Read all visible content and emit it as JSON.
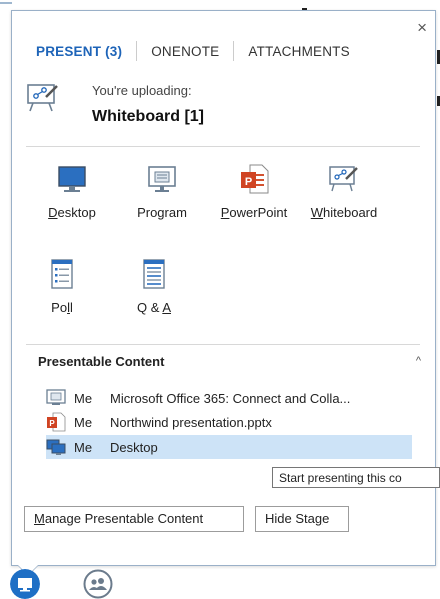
{
  "window": {
    "close_symbol": "×"
  },
  "tabs": [
    {
      "label": "PRESENT (3)",
      "active": true
    },
    {
      "label": "ONENOTE",
      "active": false
    },
    {
      "label": "ATTACHMENTS",
      "active": false
    }
  ],
  "upload": {
    "label": "You're uploading:",
    "title": "Whiteboard [1]",
    "icon": "whiteboard-icon"
  },
  "options": [
    {
      "label_pre": "",
      "label_u": "D",
      "label_post": "esktop",
      "icon": "monitor-icon"
    },
    {
      "label_pre": "Program",
      "label_u": "",
      "label_post": "",
      "icon": "program-window-icon"
    },
    {
      "label_pre": "",
      "label_u": "P",
      "label_post": "owerPoint",
      "icon": "powerpoint-icon"
    },
    {
      "label_pre": "",
      "label_u": "W",
      "label_post": "hiteboard",
      "icon": "whiteboard-icon"
    },
    {
      "label_pre": "Po",
      "label_u": "l",
      "label_post": "l",
      "icon": "poll-icon"
    },
    {
      "label_pre": "Q & ",
      "label_u": "A",
      "label_post": "",
      "icon": "qa-icon"
    }
  ],
  "presentable": {
    "header": "Presentable Content",
    "collapse_symbol": "^",
    "items": [
      {
        "who": "Me",
        "name": "Microsoft Office 365: Connect and Colla...",
        "icon": "program-window-icon",
        "selected": false
      },
      {
        "who": "Me",
        "name": "Northwind presentation.pptx",
        "icon": "powerpoint-icon",
        "selected": false
      },
      {
        "who": "Me",
        "name": "Desktop",
        "icon": "desktop-screens-icon",
        "selected": true
      }
    ]
  },
  "tooltip": "Start presenting this co",
  "buttons": {
    "manage_pre": "",
    "manage_u": "M",
    "manage_post": "anage Presentable Content",
    "hide_pre": "Hide Sta",
    "hide_u": "g",
    "hide_post": "e"
  },
  "bottom_bar": {
    "present_icon": "present-monitor-icon",
    "participants_icon": "participants-icon"
  },
  "colors": {
    "accent": "#1e64b8",
    "selection": "#cde3f7",
    "present_button": "#1f6fc5",
    "participants_button": "#6b7b8c"
  }
}
